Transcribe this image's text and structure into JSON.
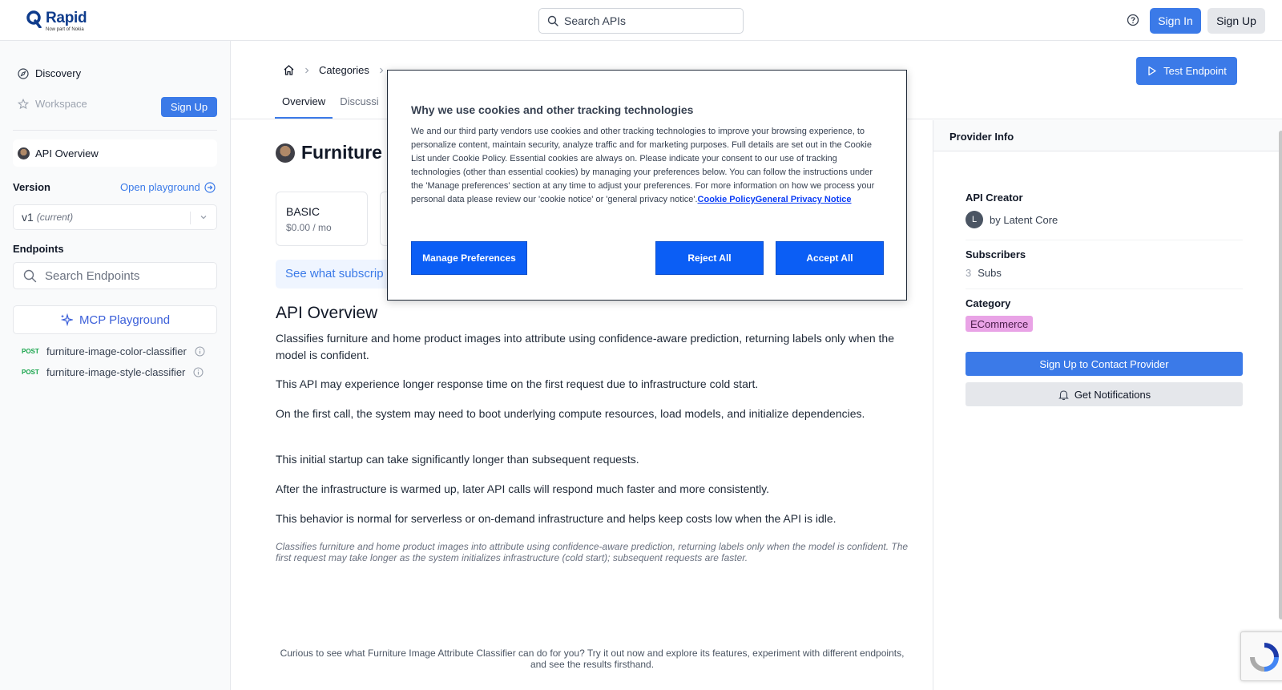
{
  "header": {
    "logo_name": "Rapid",
    "logo_sub": "Now part of Nokia",
    "search_placeholder": "Search APIs",
    "sign_in": "Sign In",
    "sign_up": "Sign Up"
  },
  "sidebar": {
    "discovery": "Discovery",
    "workspace": "Workspace",
    "sign_up": "Sign Up",
    "api_overview": "API Overview",
    "version_label": "Version",
    "open_playground": "Open playground",
    "version_value": "v1",
    "version_current": "(current)",
    "endpoints_label": "Endpoints",
    "search_endpoints": "Search Endpoints",
    "mcp_playground": "MCP Playground",
    "endpoints": [
      {
        "method": "POST",
        "name": "furniture-image-color-classifier"
      },
      {
        "method": "POST",
        "name": "furniture-image-style-classifier"
      }
    ]
  },
  "subheader": {
    "breadcrumb_categories": "Categories",
    "tabs": [
      "Overview",
      "Discussi"
    ],
    "test_endpoint": "Test Endpoint"
  },
  "content": {
    "api_title": "Furniture",
    "plan_name": "BASIC",
    "plan_price": "$0.00 / mo",
    "see_subs": "See what subscrip",
    "section_title": "API Overview",
    "paragraphs": [
      "Classifies furniture and home product images into attribute using confidence-aware prediction, returning labels only when the model is confident.",
      "This API may experience longer response time on the first request due to infrastructure cold start.",
      "On the first call, the system may need to boot underlying compute resources, load models, and initialize dependencies.",
      "This initial startup can take significantly longer than subsequent requests.",
      "After the infrastructure is warmed up, later API calls will respond much faster and more consistently.",
      "This behavior is normal for serverless or on-demand infrastructure and helps keep costs low when the API is idle."
    ],
    "italic_note": "Classifies furniture and home product images into attribute using confidence-aware prediction, returning labels only when the model is confident. The first request may take longer as the system initializes infrastructure (cold start); subsequent requests are faster.",
    "curious": "Curious to see what Furniture Image Attribute Classifier can do for you? Try it out now and explore its features, experiment with different endpoints, and see the results firsthand."
  },
  "provider": {
    "head": "Provider Info",
    "creator_label": "API Creator",
    "creator_initial": "L",
    "creator_name": "by Latent Core",
    "subscribers_label": "Subscribers",
    "subscribers_count": "3",
    "subscribers_unit": "Subs",
    "category_label": "Category",
    "category_value": "ECommerce",
    "contact_button": "Sign Up to Contact Provider",
    "notify_button": "Get Notifications"
  },
  "cookie": {
    "title": "Why we use cookies and other tracking technologies",
    "body": "We and our third party vendors use cookies and other tracking technologies to improve your browsing experience, to personalize content, maintain security, analyze traffic and for marketing purposes. Full details are set out in the Cookie List under Cookie Policy. Essential cookies are always on. Please indicate your consent to our use of tracking technologies (other than essential cookies) by managing your preferences below. You can follow the instructions under the 'Manage preferences' section at any time to adjust your preferences. For more information on how we process your personal data please review our 'cookie notice' or 'general privacy notice'.",
    "link_policy": "Cookie Policy",
    "link_privacy": "General Privacy Notice",
    "manage": "Manage Preferences",
    "reject": "Reject All",
    "accept": "Accept All"
  },
  "colors": {
    "accent": "#3b7ae8",
    "cookie_button": "#0b5ef5",
    "category_badge": "#e9a3e6"
  }
}
